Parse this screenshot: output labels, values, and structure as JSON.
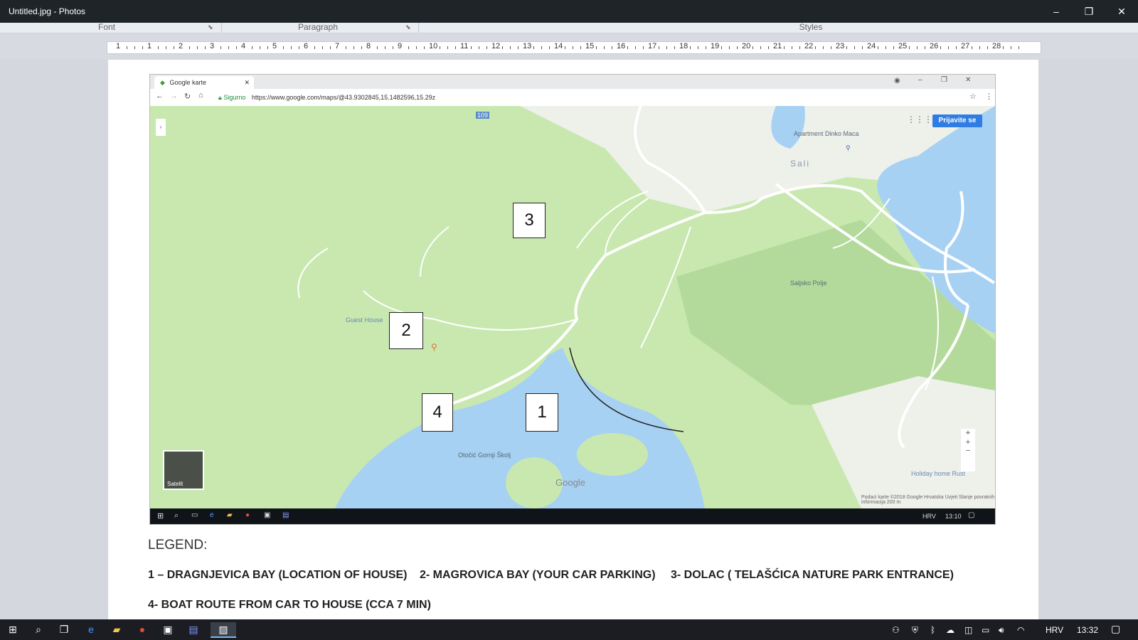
{
  "window": {
    "title": "Untitled.jpg - Photos",
    "min": "–",
    "max": "❐",
    "close": "✕"
  },
  "ribbon": {
    "font": "Font",
    "paragraph": "Paragraph",
    "styles": "Styles"
  },
  "ruler": {
    "numbers": [
      "1",
      "1",
      "2",
      "3",
      "4",
      "5",
      "6",
      "7",
      "8",
      "9",
      "10",
      "11",
      "12",
      "13",
      "14",
      "15",
      "16",
      "17",
      "18",
      "19",
      "20",
      "21",
      "22",
      "23",
      "24",
      "25",
      "26",
      "27",
      "28"
    ]
  },
  "browser": {
    "tab_title": "Google karte",
    "secure_label": "Sigurno",
    "url": "https://www.google.com/maps/@43.9302845,15.1482596,15.29z",
    "sign_in": "Prijavite se"
  },
  "map": {
    "labels": {
      "apartment": "Apartment Dinko Maca",
      "sali": "Sali",
      "saljsko_polje": "Saljsko Polje",
      "guest_house": "Guest House",
      "island": "Otočić Gornji Školj",
      "holiday": "Holiday home Rust",
      "satellite": "Satelit",
      "google": "Google",
      "road_number": "109",
      "footer": "Podaci karte ©2018 Google   Hrvatska   Uvjeti   Slanje povratnih informacija   200 m"
    },
    "markers": [
      "1",
      "2",
      "3",
      "4"
    ]
  },
  "mini_taskbar": {
    "lang": "HRV",
    "time": "13:10"
  },
  "legend": {
    "title": "LEGEND:",
    "item1": "1 – DRAGNJEVICA BAY (LOCATION OF HOUSE)",
    "item2": "2- MAGROVICA BAY (YOUR CAR PARKING)",
    "item3": "3- DOLAC ( TELAŠĆICA NATURE PARK ENTRANCE)",
    "item4": "4- BOAT ROUTE FROM CAR TO HOUSE (CCA  7 MIN)"
  },
  "taskbar": {
    "lang": "HRV",
    "time": "13:32"
  },
  "colors": {
    "titlebar": "#1f2428",
    "map_green": "#c8e8b0",
    "water": "#a7d1f3",
    "accent": "#2f7de2"
  }
}
